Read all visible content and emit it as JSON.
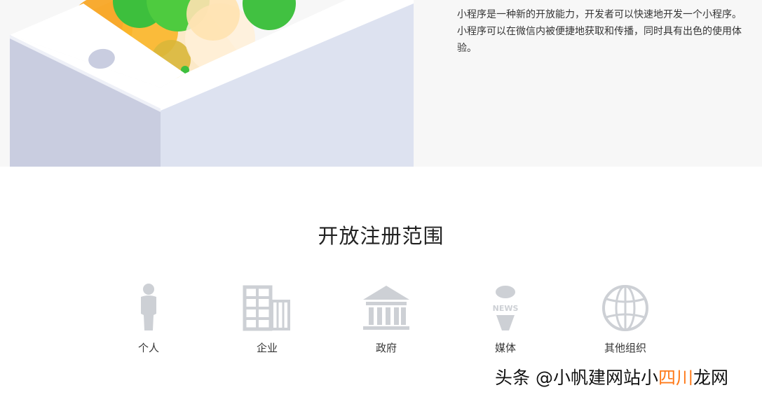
{
  "intro": {
    "text": "小程序是一种新的开放能力，开发者可以快速地开发一个小程序。小程序可以在微信内被便捷地获取和传播，同时具有出色的使用体验。"
  },
  "registration": {
    "title": "开放注册范围",
    "items": [
      {
        "label": "个人",
        "icon": "person-icon"
      },
      {
        "label": "企业",
        "icon": "building-icon"
      },
      {
        "label": "政府",
        "icon": "government-icon"
      },
      {
        "label": "媒体",
        "icon": "news-microphone-icon"
      },
      {
        "label": "其他组织",
        "icon": "globe-icon"
      }
    ]
  },
  "watermark": {
    "prefix": "头条 @小帆建网站小",
    "highlight": "四川",
    "suffix": "龙网"
  },
  "colors": {
    "icon_gray": "#cdd0d5",
    "box_face_left": "#c9cde0",
    "box_face_right": "#dde2f0",
    "green": "#3dbf3d",
    "orange": "#f7a21b"
  }
}
